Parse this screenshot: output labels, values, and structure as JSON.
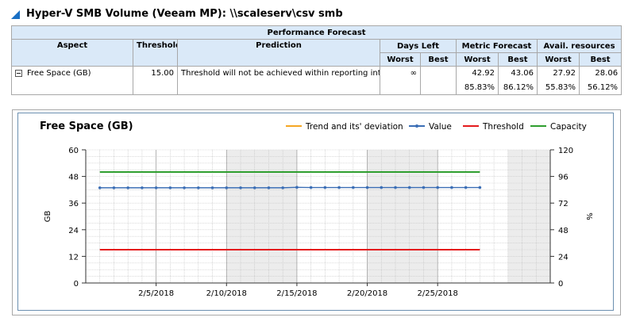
{
  "page_title": "Hyper-V SMB Volume (Veeam MP): \\\\scaleserv\\csv smb",
  "table": {
    "section_title": "Performance Forecast",
    "headers": {
      "aspect": "Aspect",
      "threshold": "Threshold",
      "prediction": "Prediction",
      "days_left": "Days Left",
      "metric_forecast": "Metric Forecast",
      "avail_resources": "Avail. resources",
      "worst": "Worst",
      "best": "Best"
    },
    "row": {
      "aspect": "Free Space (GB)",
      "threshold": "15.00",
      "prediction": "Threshold will not be achieved within reporting interval",
      "days_left_worst": "∞",
      "days_left_best": "",
      "metric_worst": "42.92",
      "metric_best": "43.06",
      "metric_worst_pct": "85.83%",
      "metric_best_pct": "86.12%",
      "avail_worst": "27.92",
      "avail_best": "28.06",
      "avail_worst_pct": "55.83%",
      "avail_best_pct": "56.12%"
    }
  },
  "colors": {
    "trend": "#f5a623",
    "value": "#3b6eb5",
    "threshold": "#e41a1c",
    "capacity": "#2e9e2e",
    "header_bg": "#dae9f8"
  },
  "chart_data": {
    "type": "line",
    "title": "Free Space (GB)",
    "ylabel": "GB",
    "y2label": "%",
    "ylim": [
      0,
      60
    ],
    "y2lim": [
      0,
      120
    ],
    "yticks": [
      "0",
      "12",
      "24",
      "36",
      "48",
      "60"
    ],
    "y2ticks": [
      "0",
      "24",
      "48",
      "72",
      "96",
      "120"
    ],
    "xlim": [
      "2018-01-31",
      "2018-03-05"
    ],
    "xtick_labels": [
      "2/5/2018",
      "2/10/2018",
      "2/15/2018",
      "2/20/2018",
      "2/25/2018"
    ],
    "xtick_dates": [
      "2018-02-05",
      "2018-02-10",
      "2018-02-15",
      "2018-02-20",
      "2018-02-25"
    ],
    "legend": [
      "Trend and its' deviation",
      "Value",
      "Threshold",
      "Capacity"
    ],
    "legend_position": "top",
    "series": [
      {
        "name": "Value",
        "x": [
          "2018-02-01",
          "2018-02-02",
          "2018-02-03",
          "2018-02-04",
          "2018-02-05",
          "2018-02-06",
          "2018-02-07",
          "2018-02-08",
          "2018-02-09",
          "2018-02-10",
          "2018-02-11",
          "2018-02-12",
          "2018-02-13",
          "2018-02-14",
          "2018-02-15",
          "2018-02-16",
          "2018-02-17",
          "2018-02-18",
          "2018-02-19",
          "2018-02-20",
          "2018-02-21",
          "2018-02-22",
          "2018-02-23",
          "2018-02-24",
          "2018-02-25",
          "2018-02-26",
          "2018-02-27",
          "2018-02-28"
        ],
        "y": [
          42.9,
          42.9,
          42.9,
          42.9,
          42.9,
          42.9,
          42.9,
          42.9,
          42.9,
          42.9,
          42.9,
          42.9,
          42.9,
          42.9,
          43.1,
          43.0,
          43.0,
          43.0,
          43.0,
          43.0,
          43.0,
          43.0,
          43.0,
          43.0,
          43.0,
          43.0,
          43.0,
          43.0
        ]
      },
      {
        "name": "Threshold",
        "x": [
          "2018-02-01",
          "2018-02-28"
        ],
        "y": [
          15,
          15
        ]
      },
      {
        "name": "Capacity",
        "x": [
          "2018-02-01",
          "2018-02-28"
        ],
        "y": [
          50,
          50
        ]
      }
    ],
    "grid": true
  }
}
